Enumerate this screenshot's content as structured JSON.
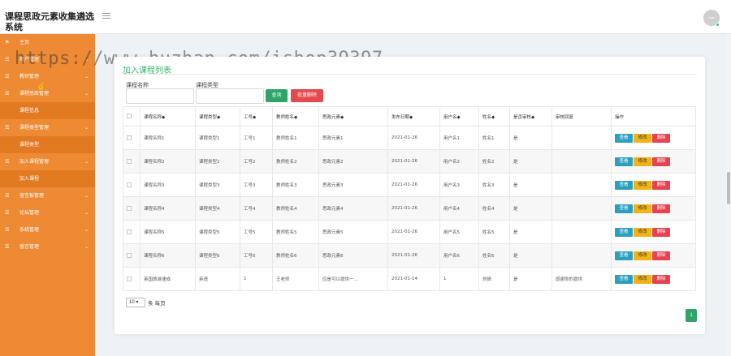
{
  "header": {
    "title": "课程思政元素收集遴选系统",
    "avatar_text": "logo"
  },
  "watermark": "https://www.huzhan.com/ishop39397",
  "sidebar": {
    "items": [
      {
        "label": "主页",
        "icon": "flag-icon",
        "sub": false,
        "chevron": false
      },
      {
        "label": "用户管理",
        "icon": "menu-icon",
        "sub": false,
        "chevron": true
      },
      {
        "label": "教师管理",
        "icon": "menu-icon",
        "sub": false,
        "chevron": true
      },
      {
        "label": "课程思政管理",
        "icon": "menu-icon",
        "sub": false,
        "chevron": true
      },
      {
        "label": "课程信息",
        "icon": "",
        "sub": true,
        "chevron": false
      },
      {
        "label": "课程类型管理",
        "icon": "menu-icon",
        "sub": false,
        "chevron": true
      },
      {
        "label": "课程类型",
        "icon": "",
        "sub": true,
        "chevron": false
      },
      {
        "label": "加入课程管理",
        "icon": "menu-icon",
        "sub": false,
        "chevron": true
      },
      {
        "label": "加入课程",
        "icon": "",
        "sub": true,
        "chevron": false
      },
      {
        "label": "留言板管理",
        "icon": "menu-icon",
        "sub": false,
        "chevron": true
      },
      {
        "label": "论坛管理",
        "icon": "menu-icon",
        "sub": false,
        "chevron": true
      },
      {
        "label": "系统管理",
        "icon": "menu-icon",
        "sub": false,
        "chevron": true
      },
      {
        "label": "留言管理",
        "icon": "menu-icon",
        "sub": false,
        "chevron": true
      }
    ]
  },
  "card": {
    "title": "加入课程列表",
    "filters": {
      "course_name_label": "课程名称",
      "course_type_label": "课程类型",
      "course_name_value": "",
      "course_type_value": ""
    },
    "buttons": {
      "query": "查询",
      "batch_delete": "批量删除"
    },
    "table": {
      "headers": [
        "课程名称◆",
        "课程类型◆",
        "工号◆",
        "教师姓名◆",
        "思政元素◆",
        "发布日期◆",
        "用户名◆",
        "姓名◆",
        "是否审核◆",
        "审核回复",
        "操作"
      ],
      "rows": [
        [
          "课程名称1",
          "课程类型1",
          "工号1",
          "教师姓名1",
          "思政元素1",
          "2021-01-26",
          "用户名1",
          "姓名1",
          "是",
          ""
        ],
        [
          "课程名称2",
          "课程类型2",
          "工号2",
          "教师姓名2",
          "思政元素2",
          "2021-01-26",
          "用户名2",
          "姓名2",
          "是",
          ""
        ],
        [
          "课程名称3",
          "课程类型3",
          "工号3",
          "教师姓名3",
          "思政元素3",
          "2021-01-26",
          "用户名3",
          "姓名3",
          "是",
          ""
        ],
        [
          "课程名称4",
          "课程类型4",
          "工号4",
          "教师姓名4",
          "思政元素4",
          "2021-01-26",
          "用户名4",
          "姓名4",
          "是",
          ""
        ],
        [
          "课程名称5",
          "课程类型5",
          "工号5",
          "教师姓名5",
          "思政元素5",
          "2021-01-26",
          "用户名5",
          "姓名5",
          "是",
          ""
        ],
        [
          "课程名称6",
          "课程类型6",
          "工号6",
          "教师姓名6",
          "思政元素6",
          "2021-01-26",
          "用户名6",
          "姓名6",
          "是",
          ""
        ],
        [
          "英国旅游速成",
          "英语",
          "1",
          "王老师",
          "应是可以提供一...",
          "2021-01-14",
          "1",
          "刘倩",
          "是",
          "感谢你的提供"
        ]
      ],
      "row_actions": {
        "view": "查看",
        "edit": "修改",
        "delete": "删除"
      }
    },
    "footer": {
      "page_size": "10 ▾",
      "page_size_label": "条 每页",
      "current_page": "1"
    }
  },
  "colors": {
    "sidebar": "#ed8a33",
    "accent_green": "#2ea468",
    "danger": "#e5484d",
    "info": "#2b9fbd",
    "warning": "#f2b318"
  }
}
